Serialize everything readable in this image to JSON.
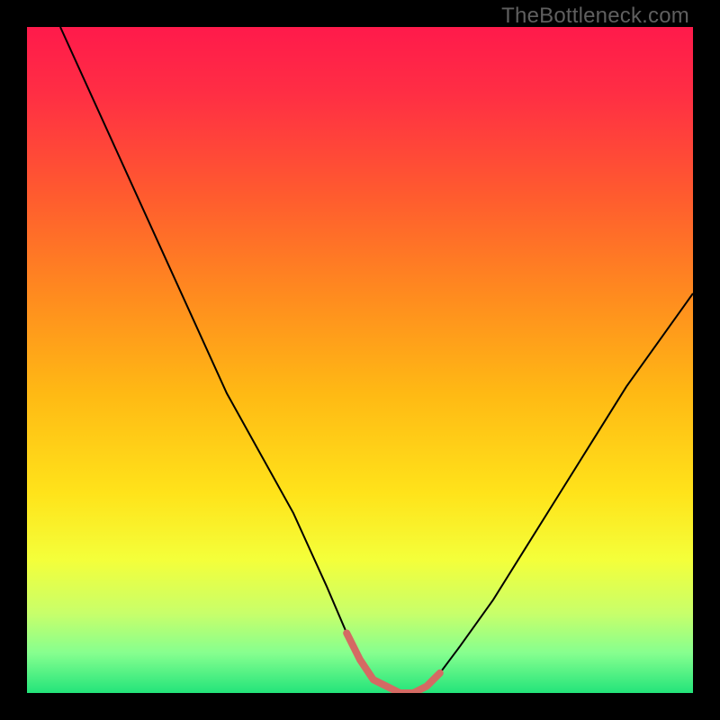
{
  "watermark": "TheBottleneck.com",
  "chart_data": {
    "type": "line",
    "title": "",
    "xlabel": "",
    "ylabel": "",
    "xlim": [
      0,
      100
    ],
    "ylim": [
      0,
      100
    ],
    "gradient_stops": [
      {
        "offset": 0.0,
        "color": "#ff1a4b"
      },
      {
        "offset": 0.1,
        "color": "#ff2e44"
      },
      {
        "offset": 0.25,
        "color": "#ff5a2f"
      },
      {
        "offset": 0.4,
        "color": "#ff8a1f"
      },
      {
        "offset": 0.55,
        "color": "#ffb914"
      },
      {
        "offset": 0.7,
        "color": "#ffe31a"
      },
      {
        "offset": 0.8,
        "color": "#f4ff3a"
      },
      {
        "offset": 0.88,
        "color": "#c8ff6a"
      },
      {
        "offset": 0.94,
        "color": "#86ff8f"
      },
      {
        "offset": 1.0,
        "color": "#23e47a"
      }
    ],
    "series": [
      {
        "name": "bottleneck-curve",
        "color": "#000000",
        "width": 2.0,
        "x": [
          5,
          10,
          15,
          20,
          25,
          30,
          35,
          40,
          45,
          48,
          50,
          52,
          54,
          56,
          58,
          60,
          62,
          65,
          70,
          75,
          80,
          85,
          90,
          95,
          100
        ],
        "y": [
          100,
          89,
          78,
          67,
          56,
          45,
          36,
          27,
          16,
          9,
          5,
          2,
          1,
          0,
          0,
          1,
          3,
          7,
          14,
          22,
          30,
          38,
          46,
          53,
          60
        ]
      },
      {
        "name": "highlight-segment",
        "color": "#d46a63",
        "width": 8.0,
        "x": [
          48,
          50,
          52,
          54,
          56,
          58,
          60,
          62
        ],
        "y": [
          9,
          5,
          2,
          1,
          0,
          0,
          1,
          3
        ]
      }
    ]
  }
}
